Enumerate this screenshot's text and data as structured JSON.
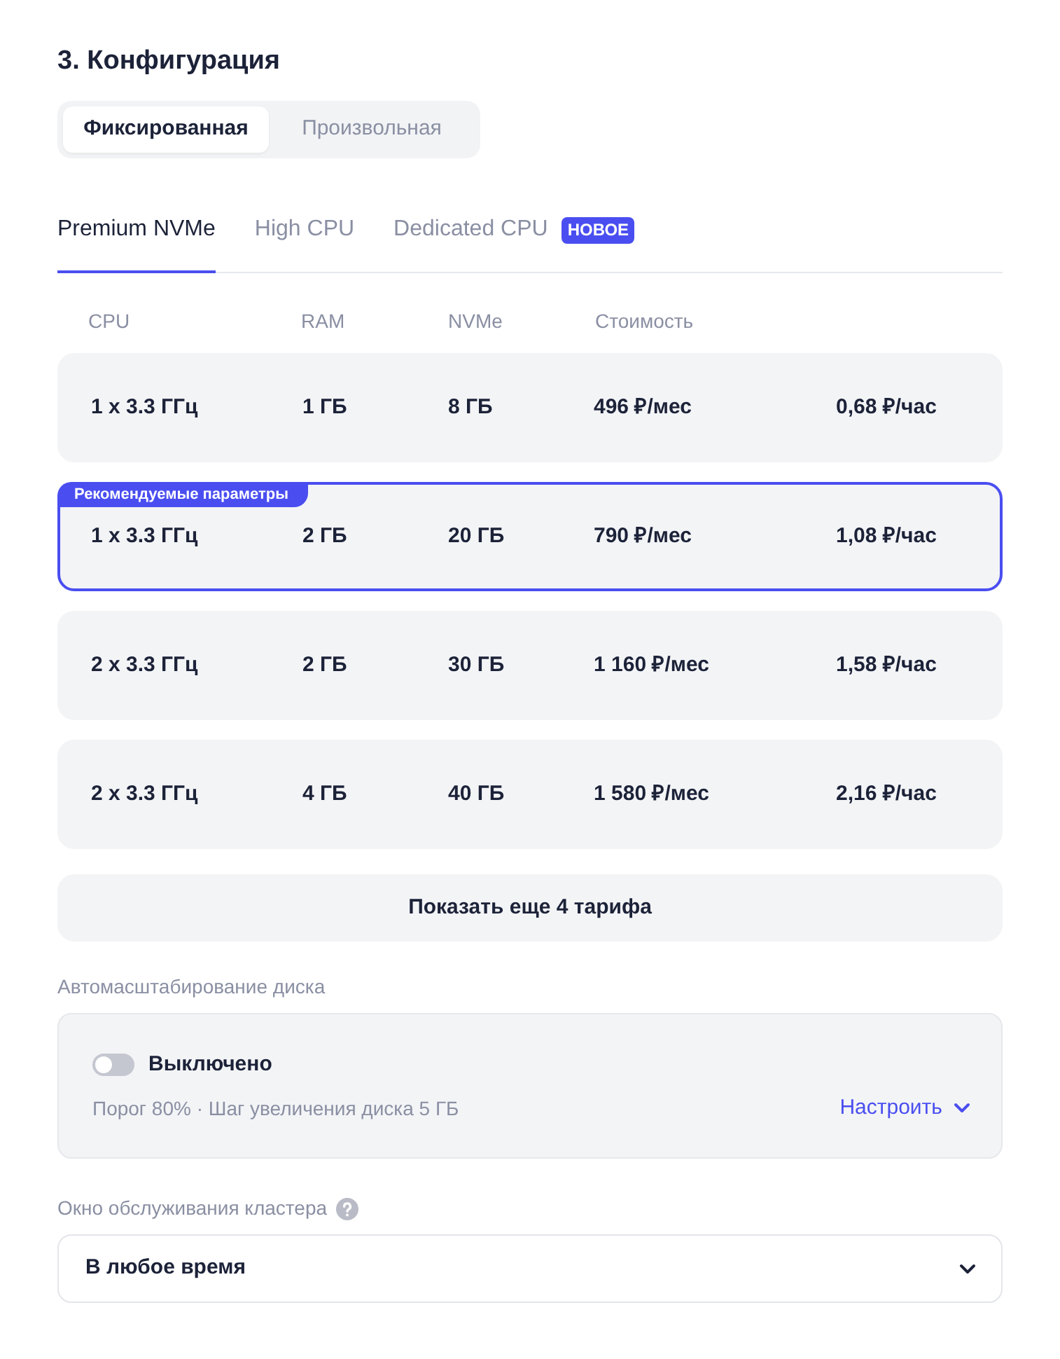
{
  "section": {
    "title": "3. Конфигурация"
  },
  "mode_switch": [
    {
      "label": "Фиксированная",
      "selected": true
    },
    {
      "label": "Произвольная",
      "selected": false
    }
  ],
  "tabs": [
    {
      "label": "Premium NVMe",
      "selected": true
    },
    {
      "label": "High CPU",
      "selected": false
    },
    {
      "label": "Dedicated CPU",
      "selected": false,
      "badge": "НОВОЕ"
    }
  ],
  "table": {
    "columns": [
      "CPU",
      "RAM",
      "NVMe",
      "Стоимость"
    ],
    "rows": [
      {
        "cpu": "1 x 3.3 ГГц",
        "ram": "1 ГБ",
        "nvme": "8 ГБ",
        "price_month": "496 ₽/мес",
        "price_hour": "0,68 ₽/час",
        "selected": false
      },
      {
        "badge": "Рекомендуемые параметры",
        "cpu": "1 x 3.3 ГГц",
        "ram": "2 ГБ",
        "nvme": "20 ГБ",
        "price_month": "790 ₽/мес",
        "price_hour": "1,08 ₽/час",
        "selected": true
      },
      {
        "cpu": "2 x 3.3 ГГц",
        "ram": "2 ГБ",
        "nvme": "30 ГБ",
        "price_month": "1 160 ₽/мес",
        "price_hour": "1,58 ₽/час",
        "selected": false
      },
      {
        "cpu": "2 x 3.3 ГГц",
        "ram": "4 ГБ",
        "nvme": "40 ГБ",
        "price_month": "1 580 ₽/мес",
        "price_hour": "2,16 ₽/час",
        "selected": false
      }
    ]
  },
  "show_more": {
    "label": "Показать еще 4 тарифа"
  },
  "autoscale": {
    "label": "Автомасштабирование диска",
    "toggle": {
      "on": false,
      "label": "Выключено"
    },
    "details": "Порог 80% · Шаг увеличения диска 5 ГБ",
    "configure_link": "Настроить"
  },
  "maintenance": {
    "label": "Окно обслуживания кластера",
    "value": "В любое время"
  }
}
